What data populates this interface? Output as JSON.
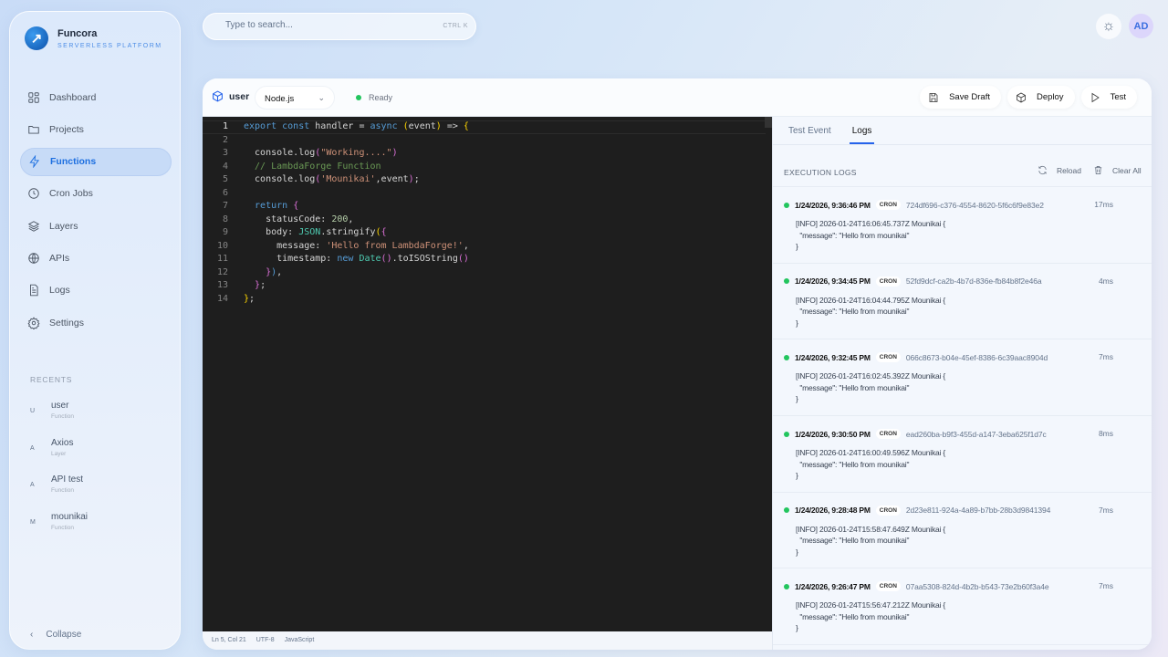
{
  "brand": {
    "name": "Funcora",
    "tagline": "SERVERLESS PLATFORM"
  },
  "nav": [
    {
      "label": "Dashboard",
      "icon": "grid-icon"
    },
    {
      "label": "Projects",
      "icon": "folder-icon"
    },
    {
      "label": "Functions",
      "icon": "bolt-icon",
      "active": true
    },
    {
      "label": "Cron Jobs",
      "icon": "clock-icon"
    },
    {
      "label": "Layers",
      "icon": "layers-icon"
    },
    {
      "label": "APIs",
      "icon": "globe-icon"
    },
    {
      "label": "Logs",
      "icon": "file-icon"
    },
    {
      "label": "Settings",
      "icon": "gear-icon"
    }
  ],
  "recents": {
    "label": "RECENTS",
    "items": [
      {
        "initial": "U",
        "name": "user",
        "type": "Function"
      },
      {
        "initial": "A",
        "name": "Axios",
        "type": "Layer"
      },
      {
        "initial": "A",
        "name": "API test",
        "type": "Function"
      },
      {
        "initial": "M",
        "name": "mounikai",
        "type": "Function"
      }
    ]
  },
  "collapse_label": "Collapse",
  "search": {
    "placeholder": "Type to search...",
    "shortcut": "CTRL K"
  },
  "user": {
    "initials": "AD"
  },
  "function": {
    "name": "user",
    "runtime": "Node.js",
    "status": "Ready",
    "status_color": "#22c55e"
  },
  "actions": {
    "save": "Save Draft",
    "deploy": "Deploy",
    "test": "Test"
  },
  "code": [
    [
      [
        "export const ",
        "k"
      ],
      [
        "handler = ",
        "p"
      ],
      [
        "async ",
        "k"
      ],
      [
        "(",
        "b"
      ],
      [
        "event",
        "p"
      ],
      [
        ")",
        "b"
      ],
      [
        " => ",
        "p"
      ],
      [
        "{",
        "b"
      ]
    ],
    [],
    [
      [
        "  console.log",
        "p"
      ],
      [
        "(",
        "b2"
      ],
      [
        "\"Working....\"",
        "s"
      ],
      [
        ")",
        "b2"
      ]
    ],
    [
      [
        "  // LambdaForge Function",
        "c"
      ]
    ],
    [
      [
        "  console.log",
        "p"
      ],
      [
        "(",
        "b2"
      ],
      [
        "'Mounikai'",
        "s"
      ],
      [
        ",event",
        "p"
      ],
      [
        ")",
        "b2"
      ],
      [
        ";",
        "p"
      ]
    ],
    [],
    [
      [
        "  return ",
        "k"
      ],
      [
        "{",
        "b2"
      ]
    ],
    [
      [
        "    statusCode: ",
        "p"
      ],
      [
        "200",
        "n"
      ],
      [
        ",",
        "p"
      ]
    ],
    [
      [
        "    body: ",
        "p"
      ],
      [
        "JSON",
        "t"
      ],
      [
        ".stringify",
        "p"
      ],
      [
        "(",
        "b"
      ],
      [
        "{",
        "b2"
      ]
    ],
    [
      [
        "      message: ",
        "p"
      ],
      [
        "'Hello from LambdaForge!'",
        "s"
      ],
      [
        ",",
        "p"
      ]
    ],
    [
      [
        "      timestamp: ",
        "p"
      ],
      [
        "new ",
        "k"
      ],
      [
        "Date",
        "t"
      ],
      [
        "()",
        "b2"
      ],
      [
        ".toISOString",
        "p"
      ],
      [
        "()",
        "b2"
      ]
    ],
    [
      [
        "    ",
        "p"
      ],
      [
        "}",
        "b2"
      ],
      [
        ")",
        "k"
      ],
      [
        ",",
        "p"
      ]
    ],
    [
      [
        "  ",
        "p"
      ],
      [
        "}",
        "b2"
      ],
      [
        ";",
        "p"
      ]
    ],
    [
      [
        "}",
        "b"
      ],
      [
        ";",
        "p"
      ]
    ]
  ],
  "statusbar": {
    "position": "Ln 5, Col 21",
    "encoding": "UTF-8",
    "language": "JavaScript"
  },
  "tabs": [
    {
      "label": "Test Event"
    },
    {
      "label": "Logs",
      "active": true
    }
  ],
  "logs": {
    "title": "EXECUTION LOGS",
    "reload": "Reload",
    "clear": "Clear All",
    "entries": [
      {
        "time": "1/24/2026, 9:36:46 PM",
        "trigger": "CRON",
        "id": "724df696-c376-4554-8620-5f6c6f9e83e2",
        "duration": "17ms",
        "body": "[INFO] 2026-01-24T16:06:45.737Z Mounikai {\n  \"message\": \"Hello from mounikai\"\n}"
      },
      {
        "time": "1/24/2026, 9:34:45 PM",
        "trigger": "CRON",
        "id": "52fd9dcf-ca2b-4b7d-836e-fb84b8f2e46a",
        "duration": "4ms",
        "body": "[INFO] 2026-01-24T16:04:44.795Z Mounikai {\n  \"message\": \"Hello from mounikai\"\n}"
      },
      {
        "time": "1/24/2026, 9:32:45 PM",
        "trigger": "CRON",
        "id": "066c8673-b04e-45ef-8386-6c39aac8904d",
        "duration": "7ms",
        "body": "[INFO] 2026-01-24T16:02:45.392Z Mounikai {\n  \"message\": \"Hello from mounikai\"\n}"
      },
      {
        "time": "1/24/2026, 9:30:50 PM",
        "trigger": "CRON",
        "id": "ead260ba-b9f3-455d-a147-3eba625f1d7c",
        "duration": "8ms",
        "body": "[INFO] 2026-01-24T16:00:49.596Z Mounikai {\n  \"message\": \"Hello from mounikai\"\n}"
      },
      {
        "time": "1/24/2026, 9:28:48 PM",
        "trigger": "CRON",
        "id": "2d23e811-924a-4a89-b7bb-28b3d9841394",
        "duration": "7ms",
        "body": "[INFO] 2026-01-24T15:58:47.649Z Mounikai {\n  \"message\": \"Hello from mounikai\"\n}"
      },
      {
        "time": "1/24/2026, 9:26:47 PM",
        "trigger": "CRON",
        "id": "07aa5308-824d-4b2b-b543-73e2b60f3a4e",
        "duration": "7ms",
        "body": "[INFO] 2026-01-24T15:56:47.212Z Mounikai {\n  \"message\": \"Hello from mounikai\"\n}"
      }
    ]
  }
}
